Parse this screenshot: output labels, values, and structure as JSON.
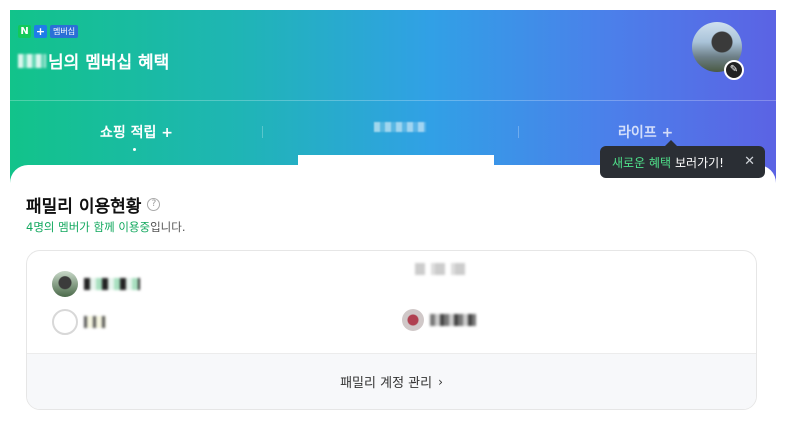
{
  "header": {
    "badge_n": "N",
    "badge_plus": "+",
    "badge_label": "멤버십",
    "title_suffix": "님의 멤버십 혜택"
  },
  "tabs": [
    {
      "label": "쇼핑 적립 +"
    },
    {
      "label": ""
    },
    {
      "label": "라이프 +"
    }
  ],
  "tooltip": {
    "highlight": "새로운 혜택",
    "text": "보러가기!",
    "close_icon": "close-icon"
  },
  "family": {
    "title": "패밀리 이용현황",
    "help_icon": "?",
    "count_text": "4명의 멤버가 함께 이용중",
    "suffix": "입니다.",
    "manage_label": "패밀리 계정 관리",
    "chevron": "›"
  },
  "colors": {
    "accent_green": "#12a85e",
    "gradient_start": "#12c38a",
    "gradient_end": "#5b63e4",
    "tooltip_bg": "#2a2e34"
  }
}
